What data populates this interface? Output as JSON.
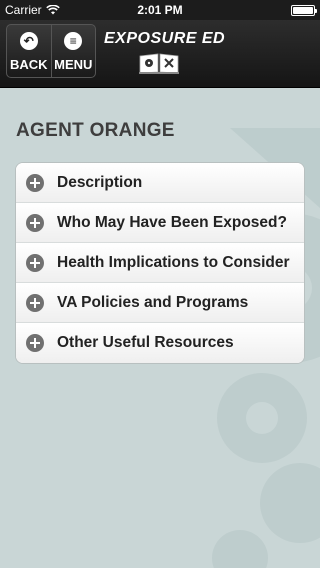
{
  "status_bar": {
    "carrier": "Carrier",
    "time": "2:01 PM",
    "battery_level": 1.0
  },
  "nav_bar": {
    "back_label": "BACK",
    "menu_label": "MENU",
    "brand_title": "EXPOSURE ED",
    "back_icon": "back-arrow-icon",
    "menu_icon": "hamburger-icon"
  },
  "page": {
    "title": "AGENT ORANGE"
  },
  "menu": {
    "items": [
      {
        "label": "Description"
      },
      {
        "label": "Who May Have Been Exposed?"
      },
      {
        "label": "Health Implications to Consider"
      },
      {
        "label": "VA Policies and Programs"
      },
      {
        "label": "Other Useful Resources"
      }
    ]
  },
  "colors": {
    "background": "#c9d6d6",
    "nav_bar": "#1f1f1f",
    "title_text": "#3e3e3e",
    "plus_icon": "#707070"
  }
}
